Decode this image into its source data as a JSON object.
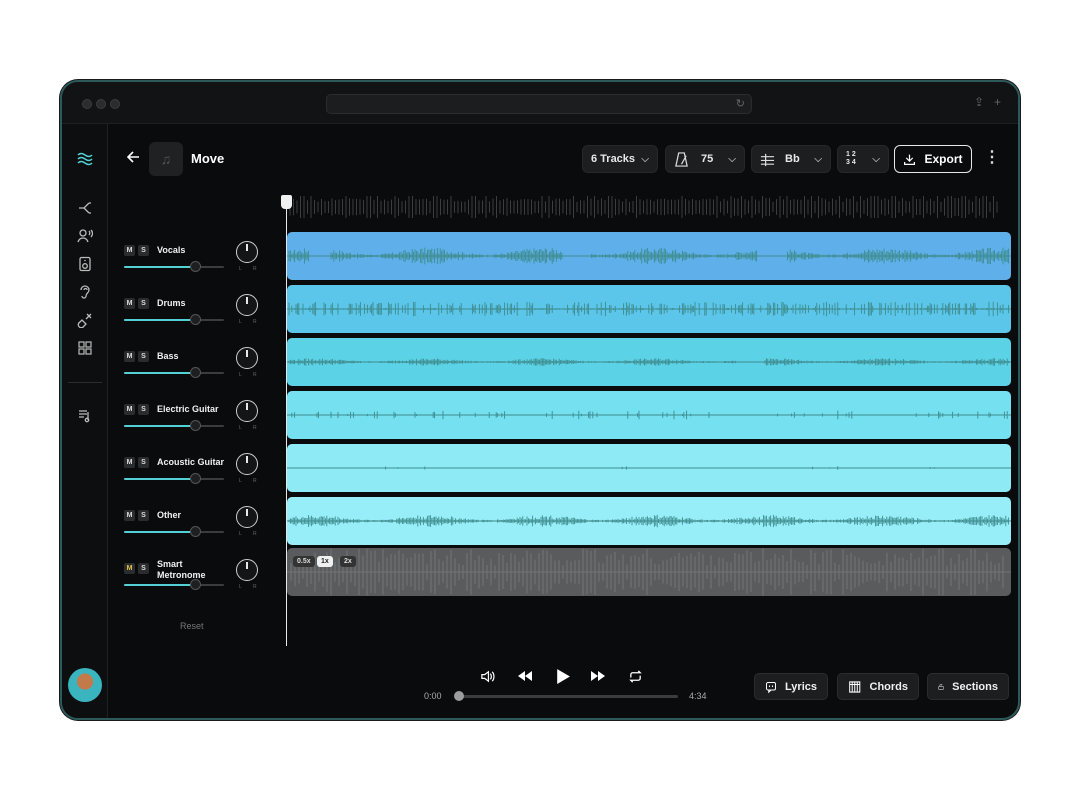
{
  "window": {
    "title": ""
  },
  "header": {
    "song_title": "Move",
    "tracks_dropdown": "6 Tracks",
    "tempo": "75",
    "key": "Bb",
    "time_sig_top": "1 2",
    "time_sig_bottom": "3 4",
    "export_label": "Export"
  },
  "tracks": [
    {
      "mute": "M",
      "solo": "S",
      "name": "Vocals",
      "volume": 0.72,
      "color": "#5fb0ea"
    },
    {
      "mute": "M",
      "solo": "S",
      "name": "Drums",
      "volume": 0.72,
      "color": "#5cc6ea"
    },
    {
      "mute": "M",
      "solo": "S",
      "name": "Bass",
      "volume": 0.72,
      "color": "#5cd2e6"
    },
    {
      "mute": "M",
      "solo": "S",
      "name": "Electric Guitar",
      "volume": 0.72,
      "color": "#74e0f0"
    },
    {
      "mute": "M",
      "solo": "S",
      "name": "Acoustic Guitar",
      "volume": 0.72,
      "color": "#8eebf6"
    },
    {
      "mute": "M",
      "solo": "S",
      "name": "Other",
      "volume": 0.72,
      "color": "#98eef8"
    }
  ],
  "metronome": {
    "mute": "M",
    "solo": "S",
    "name_line1": "Smart",
    "name_line2": "Metronome",
    "volume": 0.72,
    "speeds": [
      "0.5x",
      "1x",
      "2x"
    ],
    "active_speed": "1x"
  },
  "reset_label": "Reset",
  "knob_labels": {
    "left": "L",
    "right": "R"
  },
  "player": {
    "time_current": "0:00",
    "time_total": "4:34",
    "progress": 0.0
  },
  "bottom_buttons": {
    "lyrics": "Lyrics",
    "chords": "Chords",
    "sections": "Sections"
  },
  "colors": {
    "accent": "#52d0d6",
    "waveform": "#3e8c8e"
  }
}
